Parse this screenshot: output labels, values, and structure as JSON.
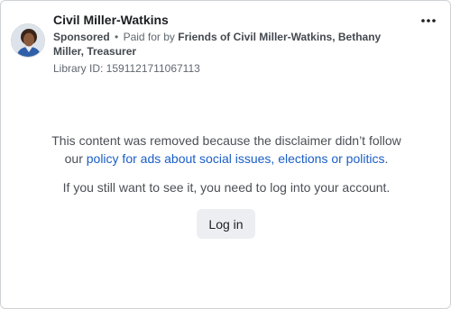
{
  "ad": {
    "advertiser_name": "Civil Miller-Watkins",
    "sponsored_label": "Sponsored",
    "separator": "•",
    "paid_for_prefix": "Paid for by",
    "paid_for_by": "Friends of Civil Miller-Watkins, Bethany Miller, Treasurer",
    "library_id": "Library ID: 1591121711067113",
    "menu_icon": "more-horizontal-icon",
    "avatar_icon": "profile-photo"
  },
  "notice": {
    "removed_text_1": "This content was removed because the disclaimer didn’t follow",
    "removed_text_2": "our",
    "policy_link": "policy for ads about social issues, elections or politics",
    "removed_text_end": ".",
    "login_prompt": "If you still want to see it, you need to log into your account.",
    "login_button": "Log in"
  },
  "colors": {
    "link": "#1a5ec7",
    "button_bg": "#eceef1",
    "border": "#cfd2d6"
  }
}
